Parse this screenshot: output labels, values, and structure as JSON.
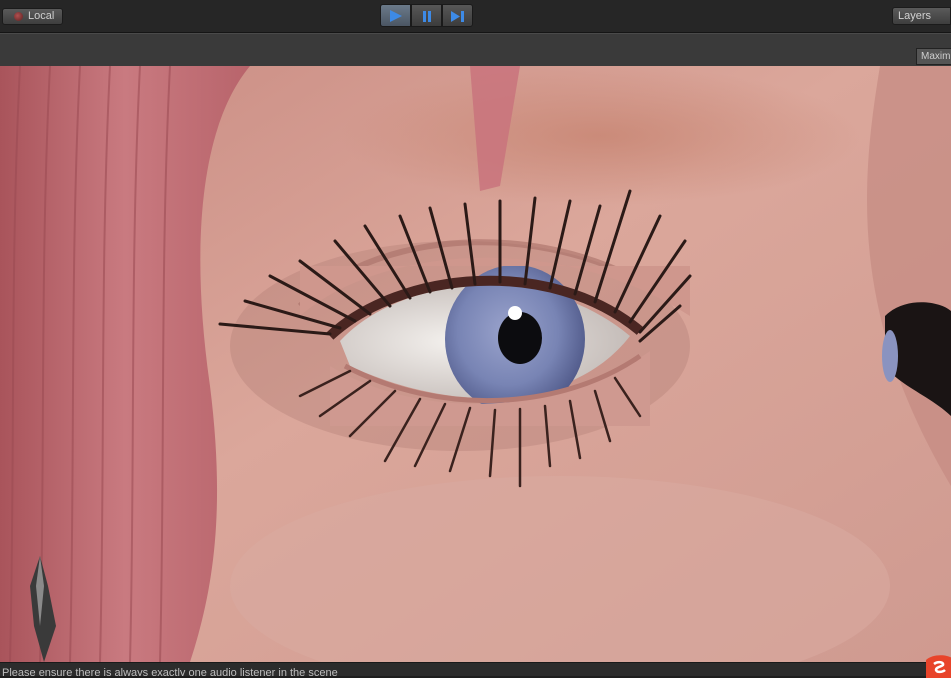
{
  "toolbar": {
    "pivot_label": "Local",
    "layers_label": "Layers",
    "accent": "#3d8ae6"
  },
  "gamebar": {
    "maximize_label": "Maximize"
  },
  "icons": [
    "pivot-icon",
    "play-icon",
    "pause-icon",
    "step-icon"
  ],
  "scene": {
    "skin": "#d9a89c",
    "hair": "#c7737a",
    "iris": "#7a86b6"
  },
  "status": {
    "message": "Please ensure there is always exactly one audio listener in the scene"
  }
}
